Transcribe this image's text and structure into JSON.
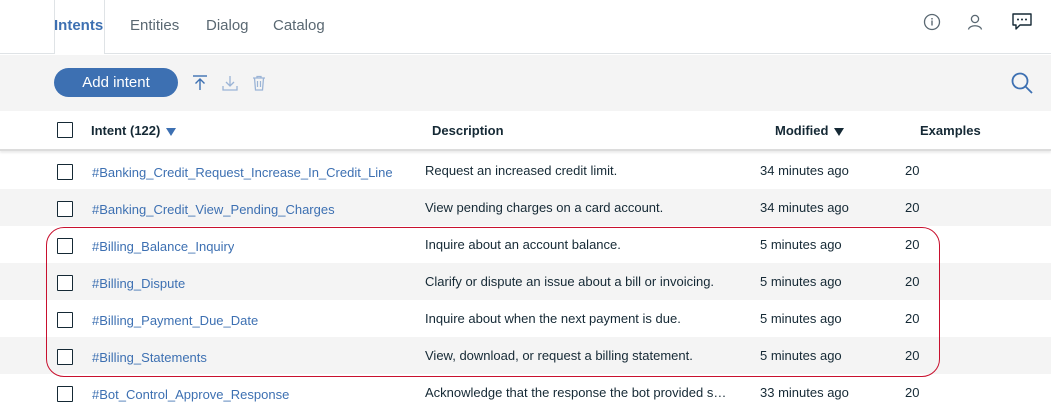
{
  "nav": {
    "tabs": [
      {
        "label": "Intents",
        "active": true
      },
      {
        "label": "Entities",
        "active": false
      },
      {
        "label": "Dialog",
        "active": false
      },
      {
        "label": "Catalog",
        "active": false
      }
    ],
    "icons": [
      "info-icon",
      "user-icon",
      "chat-icon"
    ]
  },
  "toolbar": {
    "add_label": "Add intent",
    "icons": [
      "upload-icon",
      "download-icon",
      "trash-icon",
      "search-icon"
    ]
  },
  "table": {
    "columns": {
      "intent": "Intent (122)",
      "description": "Description",
      "modified": "Modified",
      "examples": "Examples"
    },
    "rows": [
      {
        "name": "#Banking_Credit_Request_Increase_In_Credit_Line",
        "description": "Request an increased credit limit.",
        "modified": "34 minutes ago",
        "examples": "20"
      },
      {
        "name": "#Banking_Credit_View_Pending_Charges",
        "description": "View pending charges on a card account.",
        "modified": "34 minutes ago",
        "examples": "20"
      },
      {
        "name": "#Billing_Balance_Inquiry",
        "description": "Inquire about an account balance.",
        "modified": "5 minutes ago",
        "examples": "20"
      },
      {
        "name": "#Billing_Dispute",
        "description": "Clarify or dispute an issue about a bill or invoicing.",
        "modified": "5 minutes ago",
        "examples": "20"
      },
      {
        "name": "#Billing_Payment_Due_Date",
        "description": "Inquire about when the next payment is due.",
        "modified": "5 minutes ago",
        "examples": "20"
      },
      {
        "name": "#Billing_Statements",
        "description": "View, download, or request a billing statement.",
        "modified": "5 minutes ago",
        "examples": "20"
      },
      {
        "name": "#Bot_Control_Approve_Response",
        "description": "Acknowledge that the response the bot provided sati...",
        "modified": "33 minutes ago",
        "examples": "20"
      }
    ]
  },
  "colors": {
    "accent": "#3d70b2",
    "highlight": "#c8102e"
  }
}
